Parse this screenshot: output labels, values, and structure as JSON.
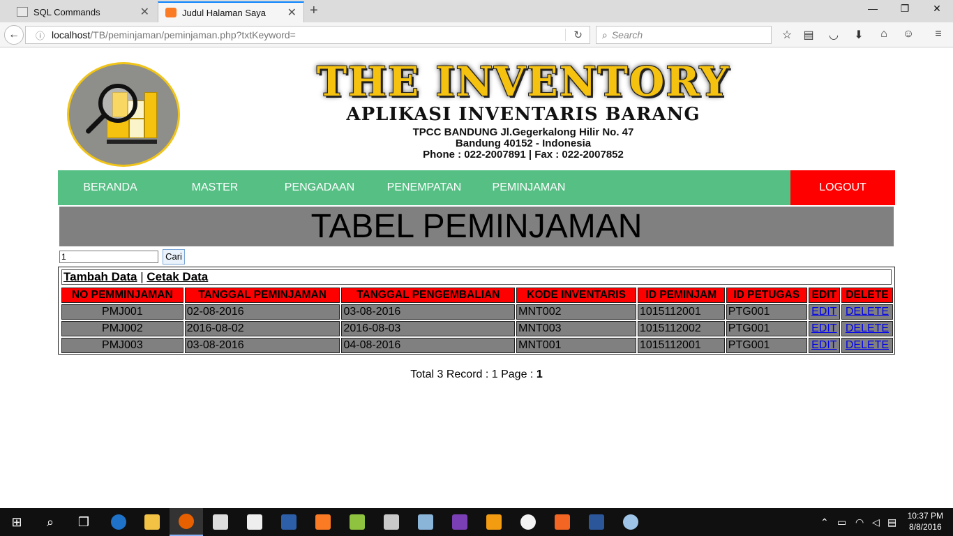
{
  "browser": {
    "tabs": [
      {
        "title": "SQL Commands",
        "active": false
      },
      {
        "title": "Judul Halaman Saya",
        "active": true
      }
    ],
    "url_host": "localhost",
    "url_path": "/TB/peminjaman/peminjaman.php?txtKeyword=",
    "search_placeholder": "Search"
  },
  "header": {
    "brand": "THE INVENTORY",
    "subtitle": "APLIKASI INVENTARIS BARANG",
    "address_line1": "TPCC BANDUNG Jl.Gegerkalong Hilir No. 47",
    "address_line2": "Bandung 40152 - Indonesia",
    "address_line3": "Phone : 022-2007891 | Fax : 022-2007852"
  },
  "menu": {
    "items": [
      "BERANDA",
      "MASTER",
      "PENGADAAN",
      "PENEMPATAN",
      "PEMINJAMAN"
    ],
    "logout": "LOGOUT",
    "bg_color": "#55bf84",
    "logout_color": "#ff0000"
  },
  "main": {
    "title": "TABEL PEMINJAMAN",
    "search_value": "1",
    "search_button": "Cari",
    "add_link": "Tambah Data",
    "separator": "|",
    "print_link": "Cetak Data",
    "columns": [
      "NO PEMMINJAMAN",
      "TANGGAL PEMINJAMAN",
      "TANGGAL PENGEMBALIAN",
      "KODE INVENTARIS",
      "ID PEMINJAM",
      "ID PETUGAS",
      "EDIT",
      "DELETE"
    ],
    "rows": [
      {
        "no": "PMJ001",
        "tgl_pinjam": "02-08-2016",
        "tgl_kembali": "03-08-2016",
        "kode": "MNT002",
        "peminjam": "1015112001",
        "petugas": "PTG001",
        "edit": "EDIT",
        "delete": "DELETE"
      },
      {
        "no": "PMJ002",
        "tgl_pinjam": "2016-08-02",
        "tgl_kembali": "2016-08-03",
        "kode": "MNT003",
        "peminjam": "1015112002",
        "petugas": "PTG001",
        "edit": "EDIT",
        "delete": "DELETE"
      },
      {
        "no": "PMJ003",
        "tgl_pinjam": "03-08-2016",
        "tgl_kembali": "04-08-2016",
        "kode": "MNT001",
        "peminjam": "1015112001",
        "petugas": "PTG001",
        "edit": "EDIT",
        "delete": "DELETE"
      }
    ],
    "footer_prefix": "Total 3 Record : 1 Page : ",
    "footer_page": "1"
  },
  "taskbar": {
    "time": "10:37 PM",
    "date": "8/8/2016"
  }
}
